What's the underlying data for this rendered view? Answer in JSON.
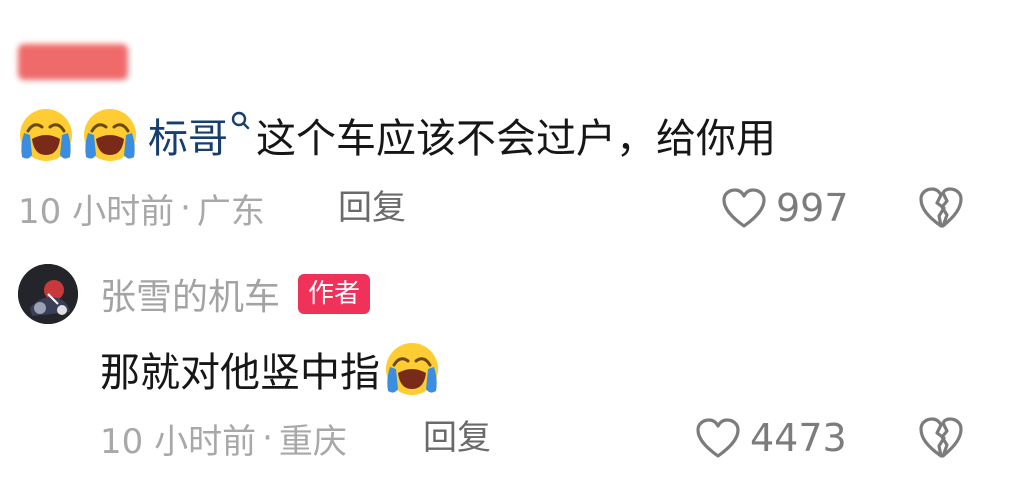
{
  "comments": [
    {
      "username_visible": false,
      "mention": "标哥",
      "text": "这个车应该不会过户，给你用",
      "emojis_before": [
        "loudly-crying-face-icon",
        "loudly-crying-face-icon"
      ],
      "time": "10 小时前",
      "separator": "·",
      "location": "广东",
      "reply_label": "回复",
      "like_count": "997"
    },
    {
      "username": "张雪的机车",
      "badge": "作者",
      "text": "那就对他竖中指",
      "emojis_after": [
        "loudly-crying-face-icon"
      ],
      "time": "10 小时前",
      "separator": "·",
      "location": "重庆",
      "reply_label": "回复",
      "like_count": "4473"
    }
  ],
  "colors": {
    "badge_bg": "#f0325a",
    "mention": "#163f6e",
    "meta_text": "#a8a8a8",
    "body_text": "#161616",
    "redaction": "#ee5a5a"
  }
}
